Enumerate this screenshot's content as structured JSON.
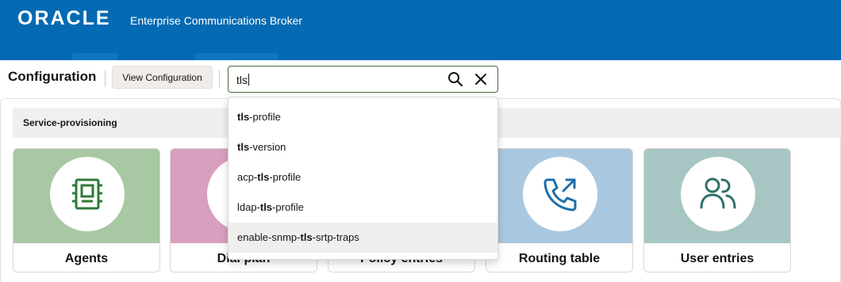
{
  "header": {
    "logo": "ORACLE",
    "product": "Enterprise Communications Broker"
  },
  "toolbar": {
    "title": "Configuration",
    "view_button": "View Configuration",
    "search_value": "tls"
  },
  "section": {
    "label": "Service-provisioning"
  },
  "cards": [
    {
      "label": "Agents",
      "color": "#a8c7a3",
      "icon": "agent-icon",
      "icon_color": "#2f7a3a"
    },
    {
      "label": "Dial plan",
      "color": "#d99fbe",
      "icon": "dial-plan-icon",
      "icon_color": "#a0325f"
    },
    {
      "label": "Policy entries",
      "color": "#d9d5cf",
      "icon": "policy-icon",
      "icon_color": "#555"
    },
    {
      "label": "Routing table",
      "color": "#a9c8df",
      "icon": "phone-forward-icon",
      "icon_color": "#1f6ea8"
    },
    {
      "label": "User entries",
      "color": "#a7c6c3",
      "icon": "users-icon",
      "icon_color": "#2e6f6a"
    }
  ],
  "suggestions": [
    {
      "pre": "",
      "match": "tls",
      "post": "-profile"
    },
    {
      "pre": "",
      "match": "tls",
      "post": "-version"
    },
    {
      "pre": "acp-",
      "match": "tls",
      "post": "-profile"
    },
    {
      "pre": "ldap-",
      "match": "tls",
      "post": "-profile"
    },
    {
      "pre": "enable-snmp-",
      "match": "tls",
      "post": "-srtp-traps"
    }
  ]
}
